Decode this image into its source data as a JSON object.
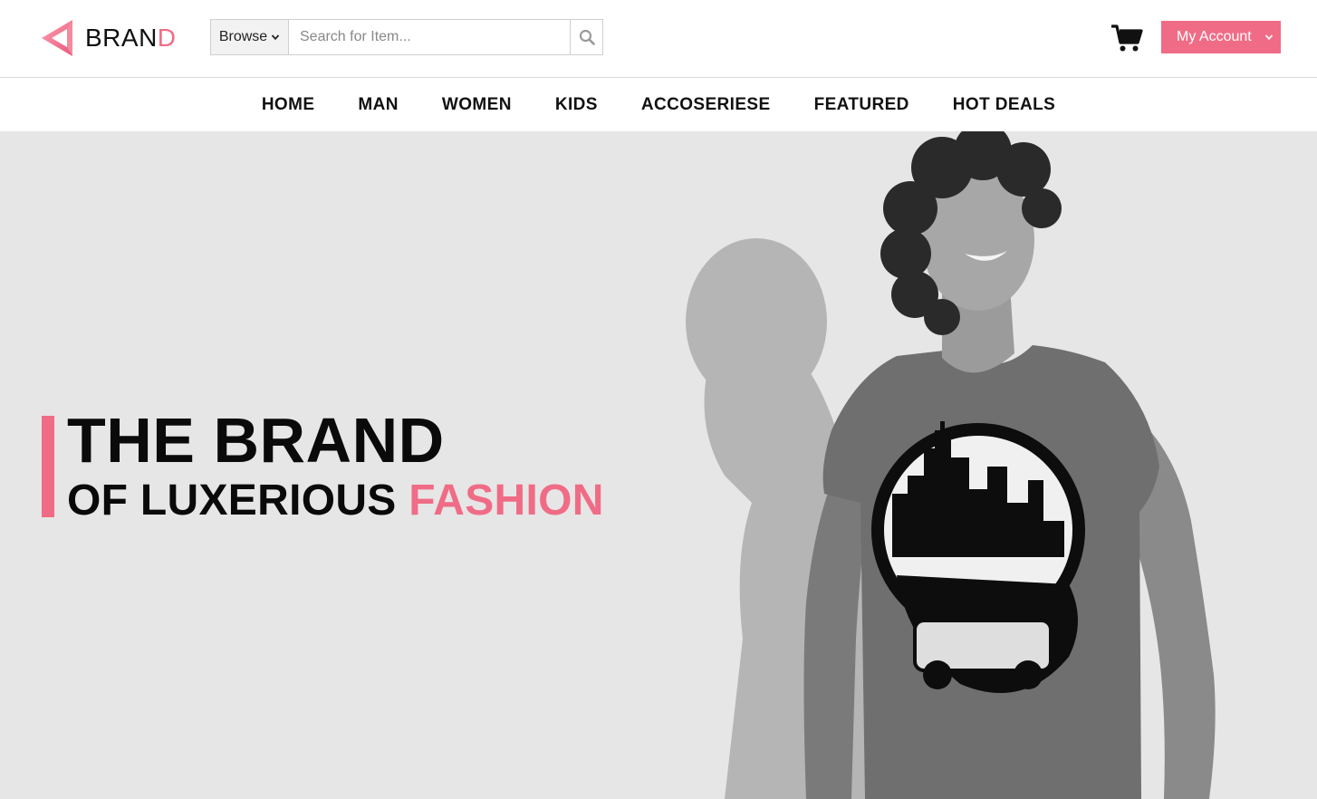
{
  "brand": {
    "name_main": "BRAN",
    "name_accent": "D",
    "accent_color": "#f06c86"
  },
  "search": {
    "browse_label": "Browse",
    "placeholder": "Search for Item...",
    "icon": "search-icon"
  },
  "header": {
    "cart_icon": "cart-icon",
    "account_label": "My Account"
  },
  "nav": {
    "items": [
      {
        "label": "HOME"
      },
      {
        "label": "MAN"
      },
      {
        "label": "WOMEN"
      },
      {
        "label": "KIDS"
      },
      {
        "label": "ACCOSERIESE"
      },
      {
        "label": "FEATURED"
      },
      {
        "label": "HOT DEALS"
      }
    ]
  },
  "hero": {
    "line1": "THE BRAND",
    "line2_main": "OF LUXERIOUS ",
    "line2_accent": "FASHION",
    "background_color": "#e6e6e6",
    "image": "hero-model-photo"
  }
}
